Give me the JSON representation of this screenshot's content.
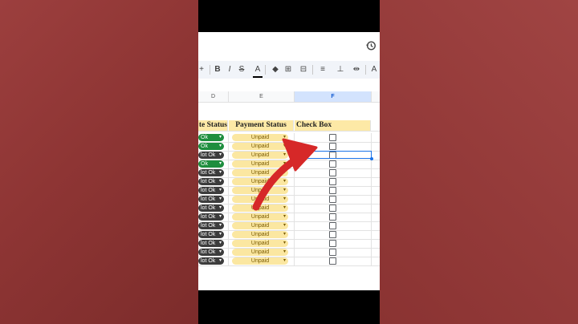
{
  "toolbar": {
    "items": [
      {
        "name": "insert-more-button",
        "label": "+"
      },
      {
        "name": "bold-button",
        "label": "B"
      },
      {
        "name": "italic-button",
        "label": "I"
      },
      {
        "name": "strikethrough-button",
        "label": "S"
      },
      {
        "name": "text-color-button",
        "label": "A"
      },
      {
        "name": "fill-color-button",
        "label": "◆"
      },
      {
        "name": "borders-button",
        "label": "⊞"
      },
      {
        "name": "merge-cells-button",
        "label": "⊟"
      },
      {
        "name": "align-horizontal-button",
        "label": "≡"
      },
      {
        "name": "align-vertical-button",
        "label": "⊥"
      },
      {
        "name": "text-wrap-button",
        "label": "⇹"
      },
      {
        "name": "text-rotation-button",
        "label": "A"
      }
    ]
  },
  "columns": [
    "D",
    "E",
    "F"
  ],
  "selected_column": "F",
  "headers": {
    "col_d": "te Status",
    "col_e": "Payment Status",
    "col_f": "Check Box"
  },
  "rows": [
    {
      "status": "Ok",
      "status_type": "ok",
      "payment": "Unpaid"
    },
    {
      "status": "Ok",
      "status_type": "ok",
      "payment": "Unpaid"
    },
    {
      "status": "lot Ok",
      "status_type": "notok",
      "payment": "Unpaid"
    },
    {
      "status": "Ok",
      "status_type": "ok",
      "payment": "Unpaid"
    },
    {
      "status": "lot Ok",
      "status_type": "notok",
      "payment": "Unpaid"
    },
    {
      "status": "lot Ok",
      "status_type": "notok",
      "payment": "Unpaid"
    },
    {
      "status": "lot Ok",
      "status_type": "notok",
      "payment": "Unpaid"
    },
    {
      "status": "lot Ok",
      "status_type": "notok",
      "payment": "Unpaid"
    },
    {
      "status": "lot Ok",
      "status_type": "notok",
      "payment": "Unpaid"
    },
    {
      "status": "lot Ok",
      "status_type": "notok",
      "payment": "Unpaid"
    },
    {
      "status": "lot Ok",
      "status_type": "notok",
      "payment": "Unpaid"
    },
    {
      "status": "lot Ok",
      "status_type": "notok",
      "payment": "Unpaid"
    },
    {
      "status": "lot Ok",
      "status_type": "notok",
      "payment": "Unpaid"
    },
    {
      "status": "lot Ok",
      "status_type": "notok",
      "payment": "Unpaid"
    },
    {
      "status": "lot Ok",
      "status_type": "notok",
      "payment": "Unpaid"
    }
  ],
  "colors": {
    "ok_chip": "#1e8e3e",
    "notok_chip": "#3c3c3c",
    "unpaid_chip": "#fbe7a1",
    "header_fill": "#fde9a6",
    "selection": "#1a73e8",
    "arrow": "#d62828"
  }
}
